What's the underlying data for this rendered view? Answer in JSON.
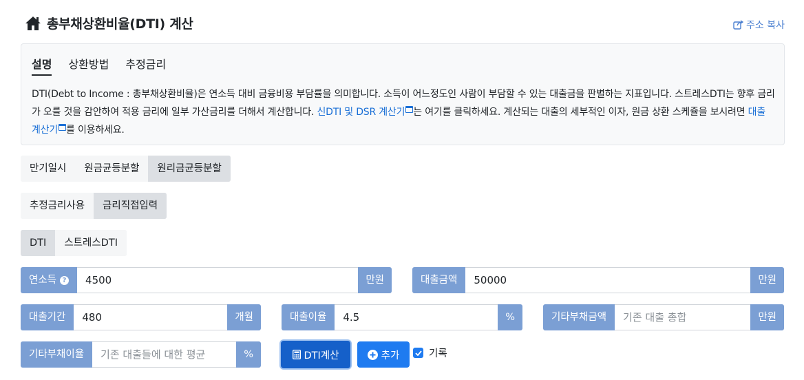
{
  "header": {
    "title": "총부채상환비율(DTI) 계산",
    "copy_link": "주소 복사"
  },
  "info": {
    "tabs": [
      "설명",
      "상환방법",
      "추정금리"
    ],
    "text_part1": "DTI(Debt to Income : 총부채상환비율)은 연소득 대비 금융비용 부담률을 의미합니다. 소득이 어느정도인 사람이 부담할 수 있는 대출금을 판별하는 지표입니다. 스트레스DTI는 향후 금리가 오를 것을 감안하여 적용 금리에 일부 가산금리를 더해서 계산합니다. ",
    "link1": "신DTI 및 DSR 계산기",
    "text_part2": "는 여기를 클릭하세요. 계산되는 대출의 세부적인 이자, 원금 상환 스케쥴을 보시려면 ",
    "link2": "대출 계산기",
    "text_part3": "를 이용하세요."
  },
  "repayment_methods": [
    "만기일시",
    "원금균등분할",
    "원리금균등분할"
  ],
  "rate_modes": [
    "추정금리사용",
    "금리직접입력"
  ],
  "dti_modes": [
    "DTI",
    "스트레스DTI"
  ],
  "fields": {
    "annual_income": {
      "label": "연소득",
      "value": "4500",
      "unit": "만원"
    },
    "loan_amount": {
      "label": "대출금액",
      "value": "50000",
      "unit": "만원"
    },
    "loan_period": {
      "label": "대출기간",
      "value": "480",
      "unit": "개월"
    },
    "loan_rate": {
      "label": "대출이율",
      "value": "4.5",
      "unit": "%"
    },
    "other_debt_amount": {
      "label": "기타부채금액",
      "placeholder": "기존 대출 총합",
      "unit": "만원"
    },
    "other_debt_rate": {
      "label": "기타부채이율",
      "placeholder": "기존 대출들에 대한 평균",
      "unit": "%"
    }
  },
  "actions": {
    "calc_label": "DTI계산",
    "add_label": "추가",
    "record_label": "기록"
  }
}
